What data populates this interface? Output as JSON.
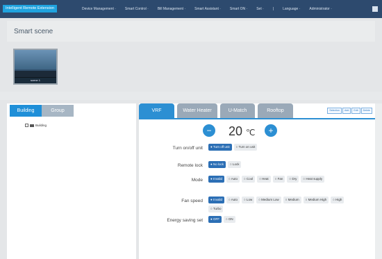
{
  "topbar": {
    "brand": "Intelligent Remote Extension",
    "nav": [
      "Device Management ·",
      "Smart Control ·",
      "Bill Management ·",
      "Smart Assistant ·",
      "Smart ON ·",
      "Set ·",
      "|",
      "Language ·",
      "Administrator ·"
    ]
  },
  "header": {
    "title": "Smart scene"
  },
  "scene": {
    "label": "scene 1"
  },
  "left": {
    "tabs": [
      "Building",
      "Group"
    ],
    "tree": {
      "label": "Building"
    }
  },
  "right": {
    "tabs": [
      "VRF",
      "Water Heater",
      "U-Match",
      "Rooftop"
    ],
    "actions": [
      "Selection",
      "Add",
      "Edit",
      "Delete"
    ],
    "temperature": {
      "minus": "−",
      "plus": "+",
      "value": "20",
      "unit": "℃"
    },
    "controls": [
      {
        "label": "Turn on/off unit",
        "options": [
          "Turn off unit",
          "Turn on unit"
        ],
        "selected": 0
      },
      {
        "label": "Remote lock",
        "options": [
          "No lock",
          "Lock"
        ],
        "selected": 0
      },
      {
        "label": "Mode",
        "options": [
          "Invalid",
          "Auto",
          "Cool",
          "Heat",
          "Fan",
          "Dry",
          "Heat supply"
        ],
        "selected": 0
      },
      {
        "label": "Fan speed",
        "options": [
          "Invalid",
          "Auto",
          "Low",
          "Medium Low",
          "Medium",
          "Medium High",
          "High",
          "Turbo"
        ],
        "selected": 0
      },
      {
        "label": "Energy saving set",
        "options": [
          "OFF",
          "ON"
        ],
        "selected": 0
      }
    ]
  }
}
